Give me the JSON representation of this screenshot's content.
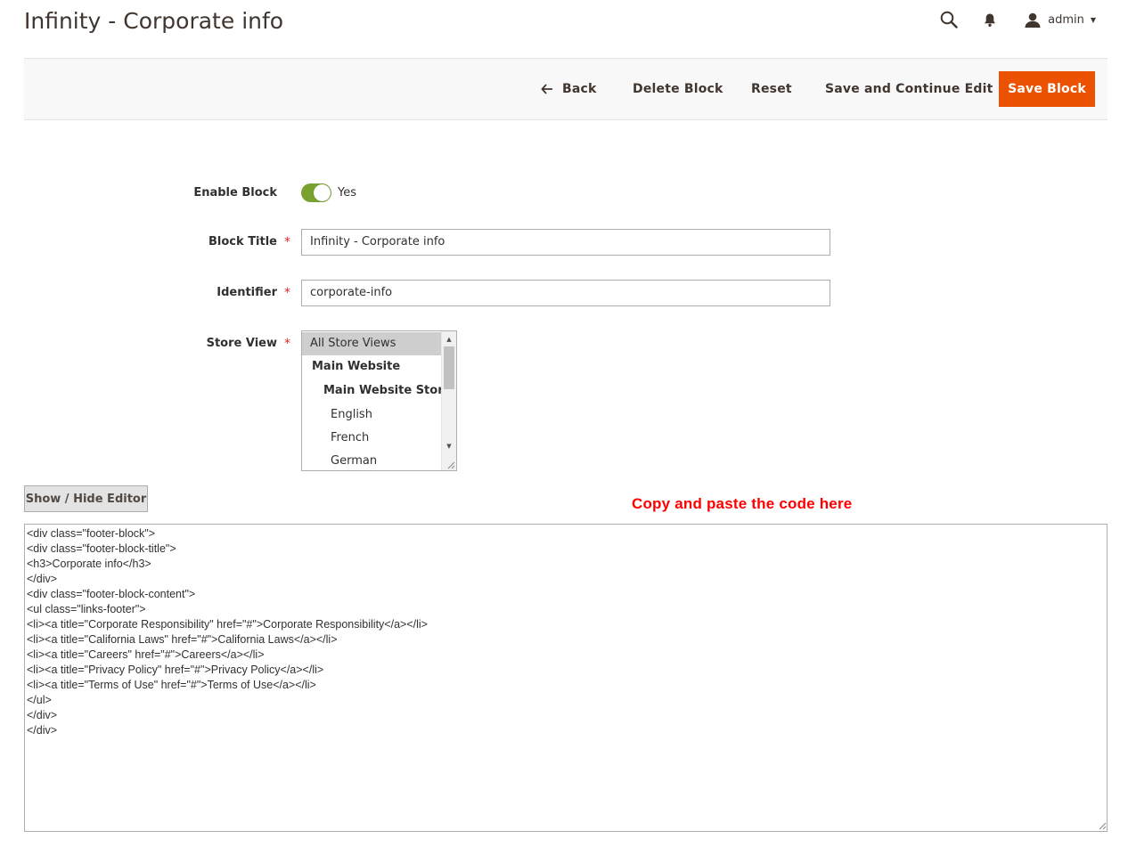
{
  "header": {
    "title": "Infinity - Corporate info",
    "user_name": "admin",
    "icons": [
      "search-icon",
      "bell-icon",
      "user-icon",
      "caret-down-icon"
    ]
  },
  "action_bar": {
    "back_label": "Back",
    "delete_label": "Delete Block",
    "reset_label": "Reset",
    "save_continue_label": "Save and Continue Edit",
    "save_label": "Save Block",
    "save_color": "#eb5202"
  },
  "form": {
    "enable": {
      "label": "Enable Block",
      "value": "Yes",
      "on": true,
      "color": "#79a22e"
    },
    "title": {
      "label": "Block Title",
      "required_mark": "*",
      "value": "Infinity - Corporate info"
    },
    "identifier": {
      "label": "Identifier",
      "required_mark": "*",
      "value": "corporate-info"
    },
    "store_view": {
      "label": "Store View",
      "required_mark": "*",
      "options": [
        {
          "label": "All Store Views",
          "selected": true
        },
        {
          "label": "Main Website"
        },
        {
          "label": "Main Website Store"
        },
        {
          "label": "English"
        },
        {
          "label": "French"
        },
        {
          "label": "German"
        }
      ]
    }
  },
  "editor": {
    "toggle_label": "Show / Hide Editor",
    "annotation": "Copy and paste the code here",
    "annotation_color": "#ff0000",
    "content": "<div class=\"footer-block\">\n<div class=\"footer-block-title\">\n<h3>Corporate info</h3>\n</div>\n<div class=\"footer-block-content\">\n<ul class=\"links-footer\">\n<li><a title=\"Corporate Responsibility\" href=\"#\">Corporate Responsibility</a></li>\n<li><a title=\"California Laws\" href=\"#\">California Laws</a></li>\n<li><a title=\"Careers\" href=\"#\">Careers</a></li>\n<li><a title=\"Privacy Policy\" href=\"#\">Privacy Policy</a></li>\n<li><a title=\"Terms of Use\" href=\"#\">Terms of Use</a></li>\n</ul>\n</div>\n</div>"
  }
}
